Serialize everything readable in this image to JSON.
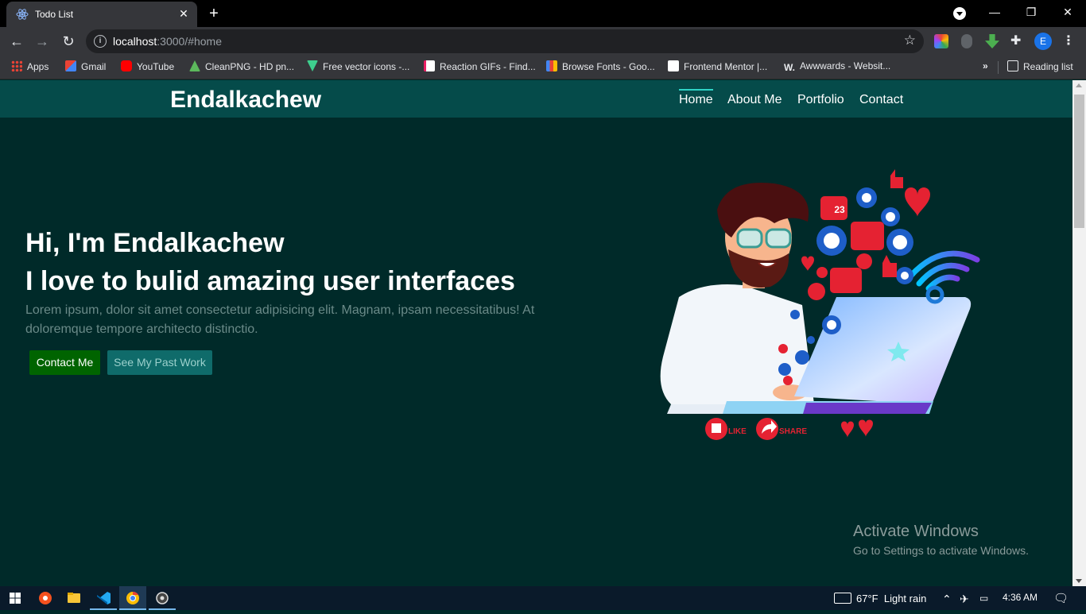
{
  "browser": {
    "tab_title": "Todo List",
    "url_host": "localhost",
    "url_rest": ":3000/#home",
    "avatar_letter": "E"
  },
  "bookmarks": [
    {
      "label": "Apps",
      "icon": "apps-grid-icon",
      "color": "#ea4335"
    },
    {
      "label": "Gmail",
      "icon": "gmail-icon",
      "color": "#ea4335"
    },
    {
      "label": "YouTube",
      "icon": "youtube-icon",
      "color": "#ff0000"
    },
    {
      "label": "CleanPNG - HD pn...",
      "icon": "cleanpng-icon",
      "color": "#5cb85c"
    },
    {
      "label": "Free vector icons -...",
      "icon": "flaticon-icon",
      "color": "#3ecf8e"
    },
    {
      "label": "Reaction GIFs - Find...",
      "icon": "page-icon",
      "color": "#e8eaed"
    },
    {
      "label": "Browse Fonts - Goo...",
      "icon": "google-fonts-icon",
      "color": "#4285f4"
    },
    {
      "label": "Frontend Mentor |...",
      "icon": "frontend-mentor-icon",
      "color": "#e8eaed"
    },
    {
      "label": "Awwwards - Websit...",
      "icon": "awwwards-icon",
      "color": "#222222"
    }
  ],
  "reading_list": "Reading list",
  "site": {
    "brand": "Endalkachew",
    "nav": [
      "Home",
      "About Me",
      "Portfolio",
      "Contact"
    ],
    "hero_line1": "Hi, I'm Endalkachew",
    "hero_line2": "I love to bulid amazing user interfaces",
    "hero_text": "Lorem ipsum, dolor sit amet consectetur adipisicing elit. Magnam, ipsam necessitatibus! At doloremque tempore architecto distinctio.",
    "btn_contact": "Contact Me",
    "btn_work": "See My Past Work",
    "illus_like": "LIKE",
    "illus_share": "SHARE",
    "illus_count": "23"
  },
  "watermark": {
    "title": "Activate Windows",
    "subtitle": "Go to Settings to activate Windows."
  },
  "taskbar": {
    "weather": "67°F",
    "weather_desc": "Light rain",
    "time": "4:36 AM"
  },
  "colors": {
    "page_bg": "#002a29",
    "nav_bg": "#054b4a",
    "primary_btn": "#006400",
    "secondary_btn": "#0f6b6a"
  }
}
